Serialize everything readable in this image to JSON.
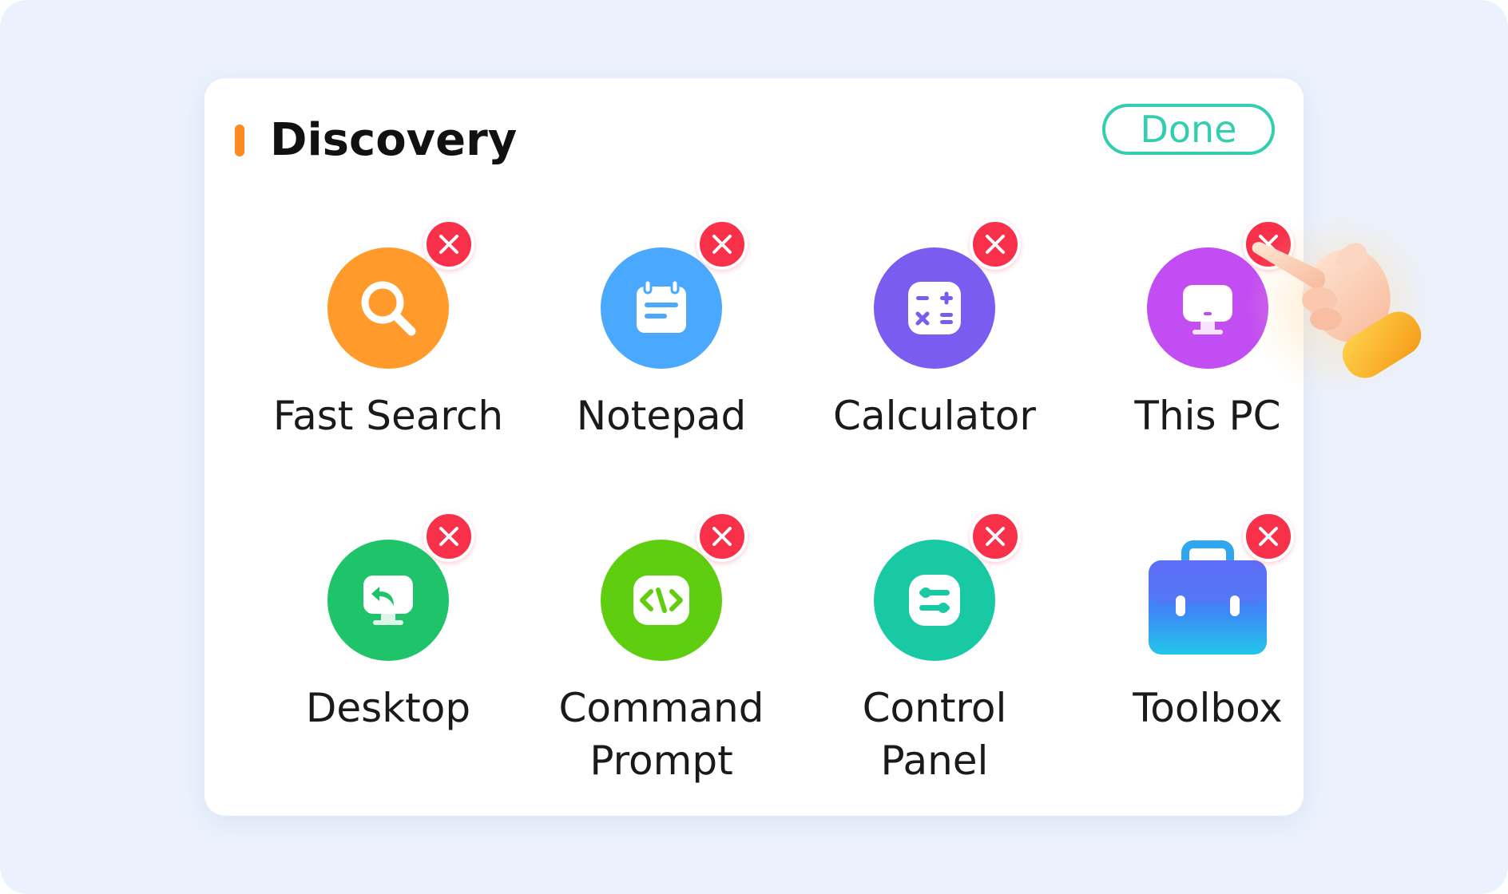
{
  "panel": {
    "title": "Discovery",
    "done_label": "Done",
    "accent_color": "#ff8a1f",
    "done_color": "#33cdb0"
  },
  "apps": [
    {
      "label": "Fast Search",
      "icon": "magnifier-icon",
      "color": "#ff9a2b"
    },
    {
      "label": "Notepad",
      "icon": "notepad-icon",
      "color": "#4aa8ff"
    },
    {
      "label": "Calculator",
      "icon": "calculator-icon",
      "color": "#7b5cf0"
    },
    {
      "label": "This PC",
      "icon": "monitor-icon",
      "color": "#c24df2"
    },
    {
      "label": "Desktop",
      "icon": "desktop-icon",
      "color": "#1fc46a"
    },
    {
      "label": "Command\nPrompt",
      "icon": "code-icon",
      "color": "#5fce10"
    },
    {
      "label": "Control\nPanel",
      "icon": "sliders-icon",
      "color": "#19c9a4"
    },
    {
      "label": "Toolbox",
      "icon": "toolbox-icon",
      "color": "#3a9cf8"
    }
  ],
  "remove_badge_icon": "close-icon",
  "remove_badge_color": "#f8304a",
  "cursor_icon": "pointing-hand-icon"
}
